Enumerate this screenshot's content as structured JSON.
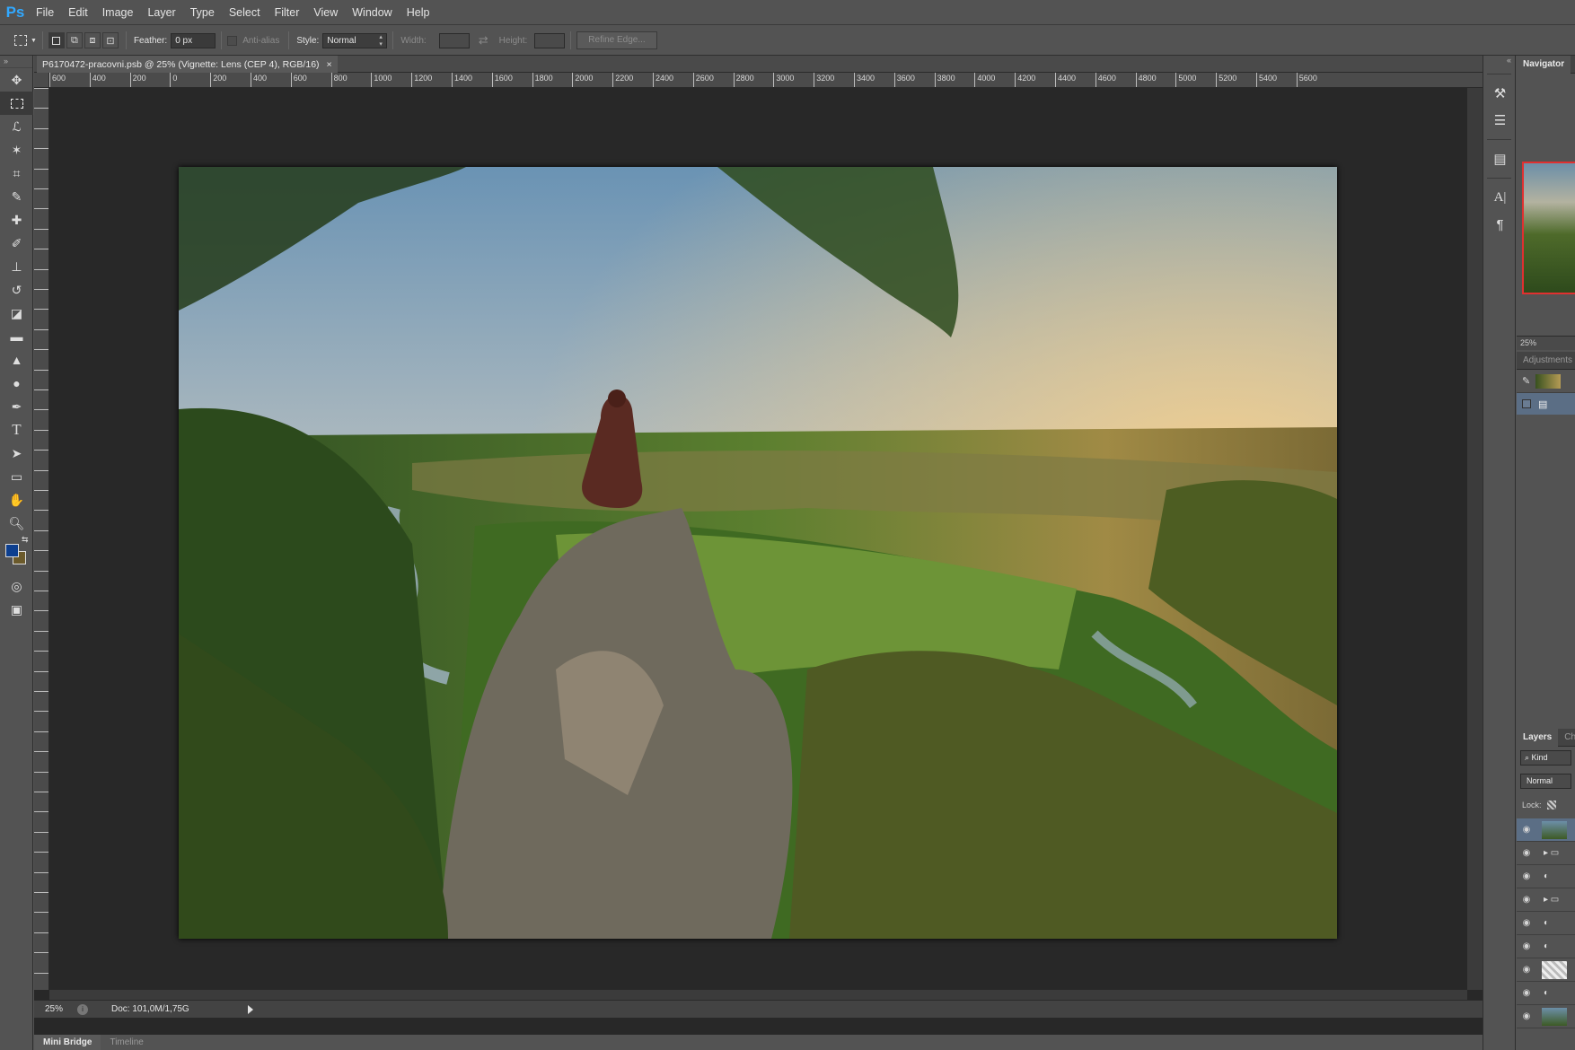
{
  "app": {
    "logo": "Ps"
  },
  "menu": [
    "File",
    "Edit",
    "Image",
    "Layer",
    "Type",
    "Select",
    "Filter",
    "View",
    "Window",
    "Help"
  ],
  "options": {
    "feather_label": "Feather:",
    "feather_value": "0 px",
    "antialias_label": "Anti-alias",
    "style_label": "Style:",
    "style_value": "Normal",
    "width_label": "Width:",
    "height_label": "Height:",
    "refine_label": "Refine Edge..."
  },
  "document": {
    "tab_title": "P6170472-pracovni.psb @ 25% (Vignette: Lens (CEP 4), RGB/16)",
    "close": "×",
    "ruler_h": [
      "600",
      "400",
      "200",
      "0",
      "200",
      "400",
      "600",
      "800",
      "1000",
      "1200",
      "1400",
      "1600",
      "1800",
      "2000",
      "2200",
      "2400",
      "2600",
      "2800",
      "3000",
      "3200",
      "3400",
      "3600",
      "3800",
      "4000",
      "4200",
      "4400",
      "4600",
      "4800",
      "5000",
      "5200",
      "5400",
      "5600"
    ]
  },
  "status": {
    "zoom": "25%",
    "doc": "Doc: 101,0M/1,75G"
  },
  "bottom_tabs": [
    "Mini Bridge",
    "Timeline"
  ],
  "panels": {
    "navigator": "Navigator",
    "nav_zoom": "25%",
    "adjustments": "Adjustments",
    "layers": "Layers",
    "channels": "Cha",
    "kind": "Kind",
    "blend": "Normal",
    "lock": "Lock:"
  },
  "colors": {
    "foreground": "#0d3f8f",
    "background": "#6b5a2b",
    "accent": "#31a8ff"
  }
}
